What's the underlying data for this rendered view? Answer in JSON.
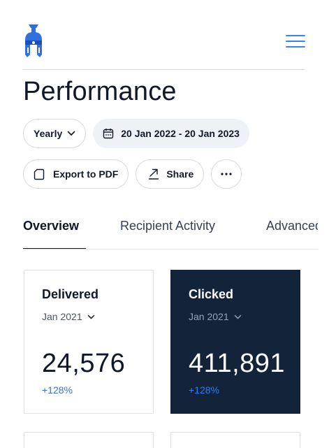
{
  "header": {
    "logo_icon": "spartan-helmet-icon",
    "menu_icon": "hamburger-menu-icon",
    "accent": "#3b82f6"
  },
  "page": {
    "title": "Performance"
  },
  "filters": {
    "period_select": "Yearly",
    "date_range": "20 Jan 2022 - 20 Jan 2023"
  },
  "actions": {
    "export_label": "Export to PDF",
    "share_label": "Share",
    "more_icon": "ellipsis-icon"
  },
  "tabs": [
    {
      "label": "Overview",
      "active": true
    },
    {
      "label": "Recipient Activity",
      "active": false
    },
    {
      "label": "Advanced",
      "active": false
    }
  ],
  "cards": [
    {
      "title": "Delivered",
      "period": "Jan 2021",
      "value": "24,576",
      "change": "+128%",
      "theme": "light"
    },
    {
      "title": "Clicked",
      "period": "Jan 2021",
      "value": "411,891",
      "change": "+128%",
      "theme": "dark"
    }
  ],
  "colors": {
    "dark_card": "#13243a",
    "change_text": "#3b6fd4"
  }
}
